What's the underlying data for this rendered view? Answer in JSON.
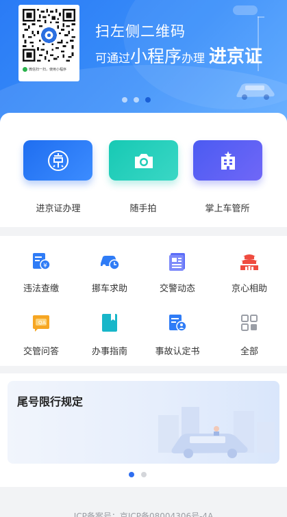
{
  "banner": {
    "qr_caption": "微信扫一扫，使用小程序",
    "line1": "扫左侧二维码",
    "line2_part1": "可通过",
    "line2_part2": "小程序",
    "line2_part3": "办理",
    "line2_part4": "进京证",
    "active_slide": 3,
    "slide_count": 3
  },
  "primary": [
    {
      "label": "进京证办理",
      "icon": "jing-badge-icon"
    },
    {
      "label": "随手拍",
      "icon": "camera-icon"
    },
    {
      "label": "掌上车管所",
      "icon": "building-icon"
    }
  ],
  "services": [
    {
      "label": "违法查缴",
      "icon": "violation-payment-icon",
      "color": "#2f7cf6"
    },
    {
      "label": "挪车求助",
      "icon": "car-clock-icon",
      "color": "#2f7cf6"
    },
    {
      "label": "交警动态",
      "icon": "news-icon",
      "color": "#5b6cf7"
    },
    {
      "label": "京心相助",
      "icon": "tiananmen-icon",
      "color": "#ef4b3f"
    },
    {
      "label": "交管问答",
      "icon": "qa-chat-icon",
      "color": "#f6a623"
    },
    {
      "label": "办事指南",
      "icon": "guide-book-icon",
      "color": "#18b6c9"
    },
    {
      "label": "事故认定书",
      "icon": "accident-doc-icon",
      "color": "#2f7cf6"
    },
    {
      "label": "全部",
      "icon": "grid-all-icon",
      "color": "#9a9ea6"
    }
  ],
  "tail_card": {
    "title": "尾号限行规定",
    "active_slide": 1,
    "slide_count": 2
  },
  "footer": {
    "icp": "ICP备案号：京ICP备08004306号-4A"
  }
}
